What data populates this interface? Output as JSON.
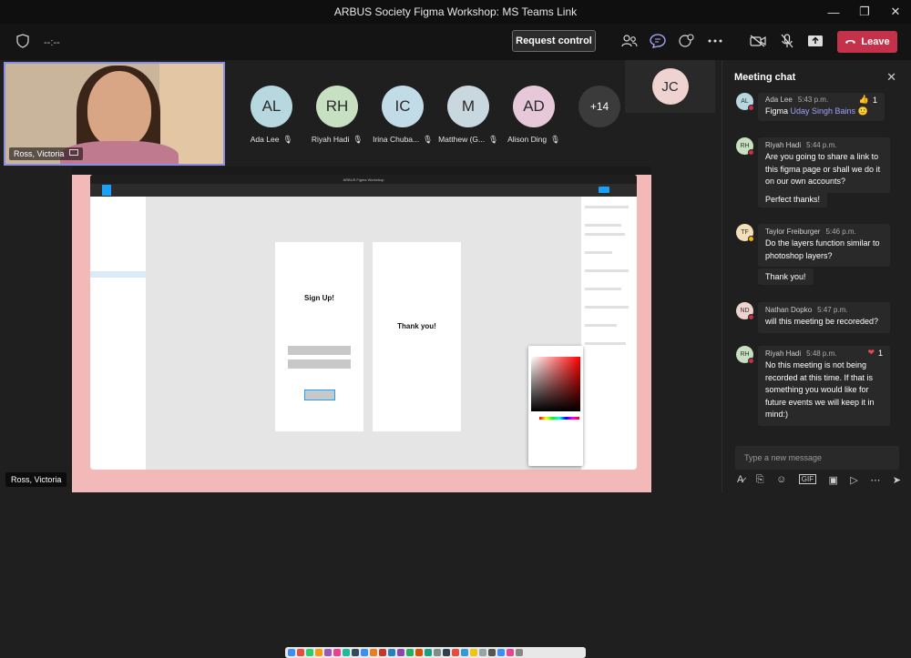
{
  "window": {
    "title": "ARBUS Society Figma Workshop: MS Teams Link",
    "controls": [
      "—",
      "❐",
      "✕"
    ]
  },
  "toolbar": {
    "timer": "--:--",
    "request_control": "Request control",
    "leave": "Leave"
  },
  "self_video": {
    "name": "Ross, Victoria"
  },
  "bottom_name": "Ross, Victoria",
  "participants": [
    {
      "initials": "AL",
      "name": "Ada Lee",
      "color": "#b8d8e0"
    },
    {
      "initials": "RH",
      "name": "Riyah Hadi",
      "color": "#c7e0c1"
    },
    {
      "initials": "IC",
      "name": "Irina Chuba...",
      "color": "#c1dce6"
    },
    {
      "initials": "M",
      "name": "Matthew (G...",
      "color": "#c9d8de"
    },
    {
      "initials": "AD",
      "name": "Alison Ding",
      "color": "#e6c8d8"
    }
  ],
  "more_count": "+14",
  "spotlight": {
    "initials": "JC",
    "color": "#efd3d0"
  },
  "shared_screen": {
    "app_title": "ARBUS Figma Workshop",
    "frame1_text": "Sign Up!",
    "frame2_text": "Thank you!"
  },
  "chat": {
    "title": "Meeting chat",
    "composer_placeholder": "Type a new message",
    "messages": [
      {
        "initials": "AL",
        "author": "Ada Lee",
        "time": "5:43 p.m.",
        "body_prefix": "Figma ",
        "mention": "Uday Singh Bains",
        "emoji": "🙂",
        "reaction": "👍",
        "reaction_count": "1",
        "color": "#b8d8e0"
      },
      {
        "initials": "RH",
        "author": "Riyah Hadi",
        "time": "5:44 p.m.",
        "body": "Are you going to share a link to this figma page or shall we do it on our own accounts?",
        "followup": "Perfect thanks!",
        "color": "#c7e0c1"
      },
      {
        "initials": "TF",
        "author": "Taylor Freiburger",
        "time": "5:46 p.m.",
        "body": "Do the layers function similar to photoshop layers?",
        "followup": "Thank you!",
        "color": "#f3e0b8"
      },
      {
        "initials": "ND",
        "author": "Nathan Dopko",
        "time": "5:47 p.m.",
        "body": "will this meeting be recoreded?",
        "color": "#efd3d0"
      },
      {
        "initials": "RH",
        "author": "Riyah Hadi",
        "time": "5:48 p.m.",
        "body": "No this meeting is not being recorded at this time. If that is something you would like for future events we will keep it in mind:)",
        "reaction": "❤",
        "reaction_count": "1",
        "color": "#c7e0c1"
      }
    ]
  }
}
